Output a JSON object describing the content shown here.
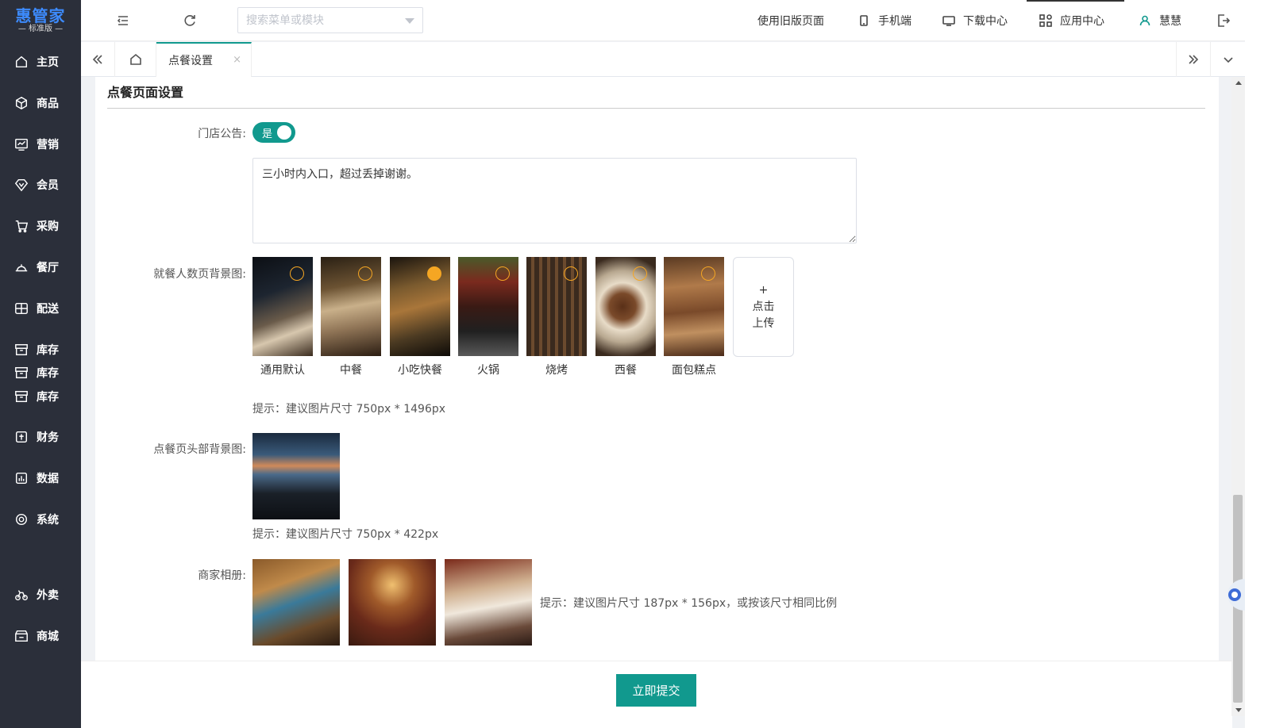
{
  "brand": {
    "name": "惠管家",
    "edition": "— 标准版 —"
  },
  "sidebar": {
    "items": [
      {
        "label": "主页",
        "icon": "home-icon"
      },
      {
        "label": "商品",
        "icon": "cube-icon"
      },
      {
        "label": "营销",
        "icon": "chart-icon"
      },
      {
        "label": "会员",
        "icon": "diamond-icon"
      },
      {
        "label": "采购",
        "icon": "cart-icon"
      },
      {
        "label": "餐厅",
        "icon": "dish-icon"
      },
      {
        "label": "配送",
        "icon": "delivery-icon"
      },
      {
        "label": "库存",
        "icon": "box-icon"
      },
      {
        "label": "库存",
        "icon": "box-icon"
      },
      {
        "label": "库存",
        "icon": "box-icon"
      },
      {
        "label": "财务",
        "icon": "finance-icon"
      },
      {
        "label": "数据",
        "icon": "data-icon"
      },
      {
        "label": "系统",
        "icon": "settings-icon"
      },
      {
        "label": "外卖",
        "icon": "bike-icon"
      },
      {
        "label": "商城",
        "icon": "store-icon"
      }
    ]
  },
  "topbar": {
    "search_placeholder": "搜索菜单或模块",
    "old_version": "使用旧版页面",
    "mobile": "手机端",
    "download": "下载中心",
    "apps": "应用中心",
    "user": "慧慧"
  },
  "tabs": {
    "active_label": "点餐设置",
    "close": "×"
  },
  "form": {
    "section_title": "点餐页面设置",
    "notice_label": "门店公告:",
    "notice_switch": "是",
    "notice_text": "三小时内入口，超过丢掉谢谢。",
    "bg_label": "就餐人数页背景图:",
    "bg_options": [
      {
        "caption": "通用默认",
        "selected": false
      },
      {
        "caption": "中餐",
        "selected": false
      },
      {
        "caption": "小吃快餐",
        "selected": true
      },
      {
        "caption": "火锅",
        "selected": false
      },
      {
        "caption": "烧烤",
        "selected": false
      },
      {
        "caption": "西餐",
        "selected": false
      },
      {
        "caption": "面包糕点",
        "selected": false
      }
    ],
    "upload_plus": "+",
    "upload_line1": "点击",
    "upload_line2": "上传",
    "bg_hint": "提示：建议图片尺寸 750px * 1496px",
    "header_label": "点餐页头部背景图:",
    "header_hint": "提示：建议图片尺寸 750px * 422px",
    "album_label": "商家相册:",
    "album_hint": "提示：建议图片尺寸 187px * 156px，或按该尺寸相同比例"
  },
  "footer": {
    "submit": "立即提交"
  },
  "colors": {
    "accent": "#11998e",
    "sidebar": "#2b2f3a",
    "brand": "#3d8bfd",
    "pick": "#f5a623"
  }
}
